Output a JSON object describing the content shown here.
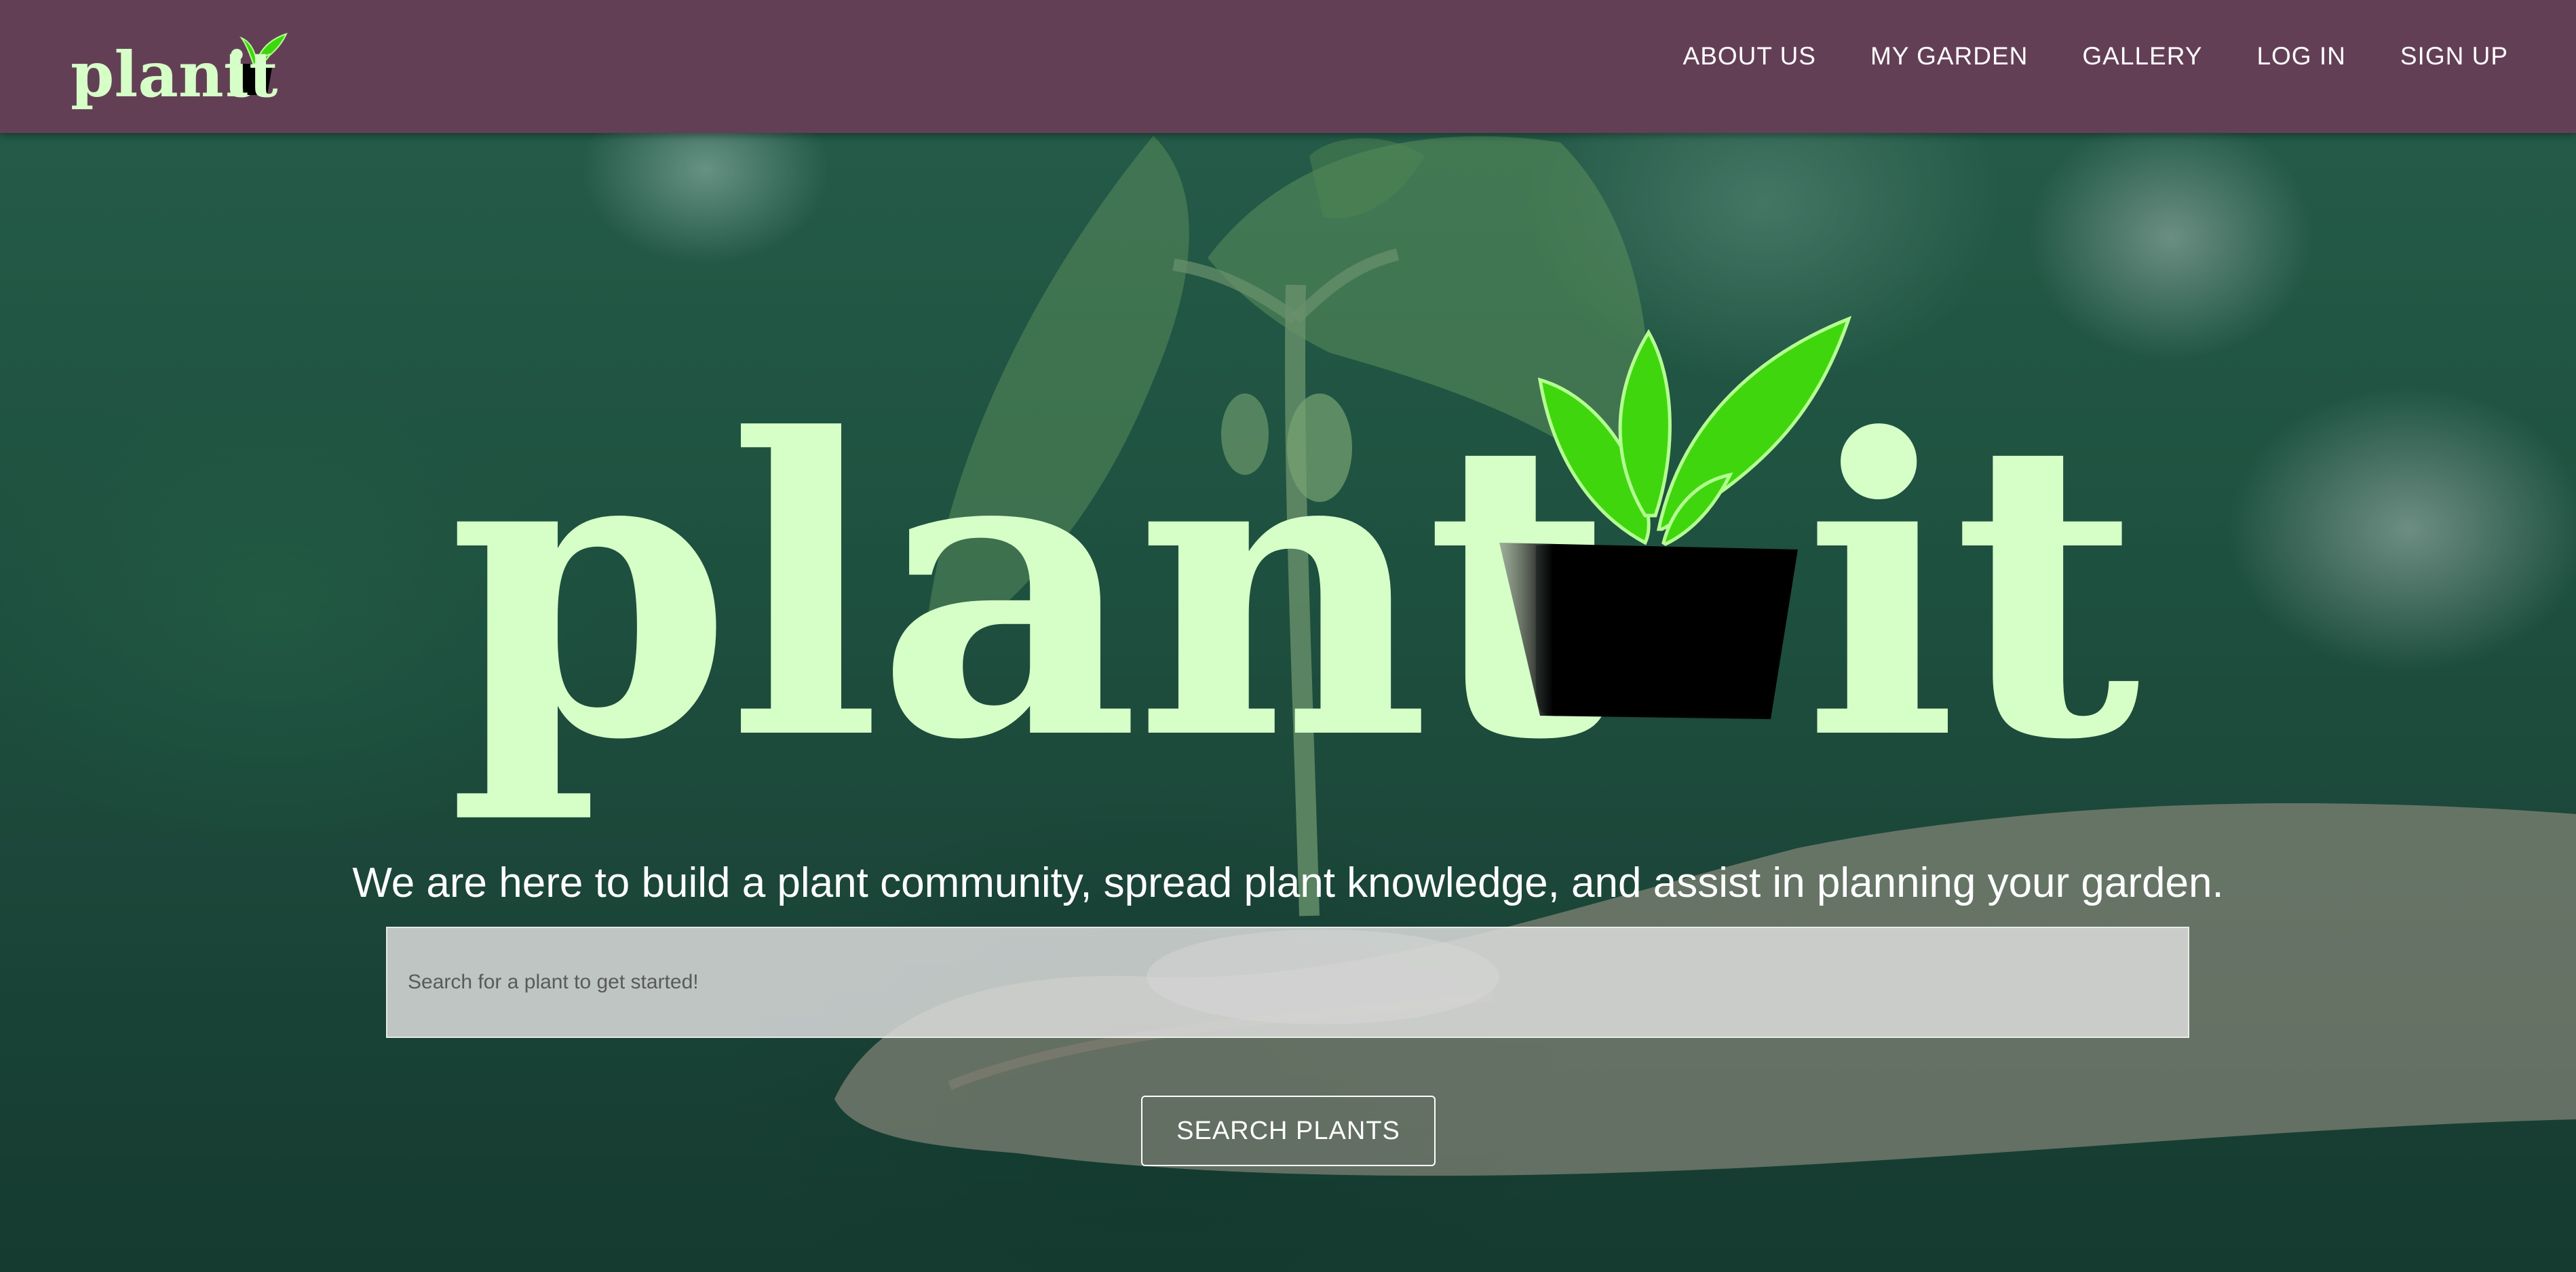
{
  "brand": {
    "name_part1": "plant",
    "name_part2": "it"
  },
  "nav": {
    "items": [
      {
        "label": "ABOUT US"
      },
      {
        "label": "MY GARDEN"
      },
      {
        "label": "GALLERY"
      },
      {
        "label": "LOG IN"
      },
      {
        "label": "SIGN UP"
      }
    ]
  },
  "hero": {
    "logo_part1": "plant",
    "logo_part2": "it",
    "tagline": "We are here to build a plant community, spread plant knowledge, and assist in planning your garden.",
    "search_placeholder": "Search for a plant to get started!",
    "search_button_label": "SEARCH PLANTS"
  },
  "colors": {
    "navbar_bg": "#633f55",
    "logo_text": "#d6ffc8",
    "leaf_green": "#3fd60e",
    "pot": "#000000"
  },
  "icons": {
    "brand_icon": "potted-sprout-icon",
    "hero_icon": "potted-sprout-icon"
  }
}
